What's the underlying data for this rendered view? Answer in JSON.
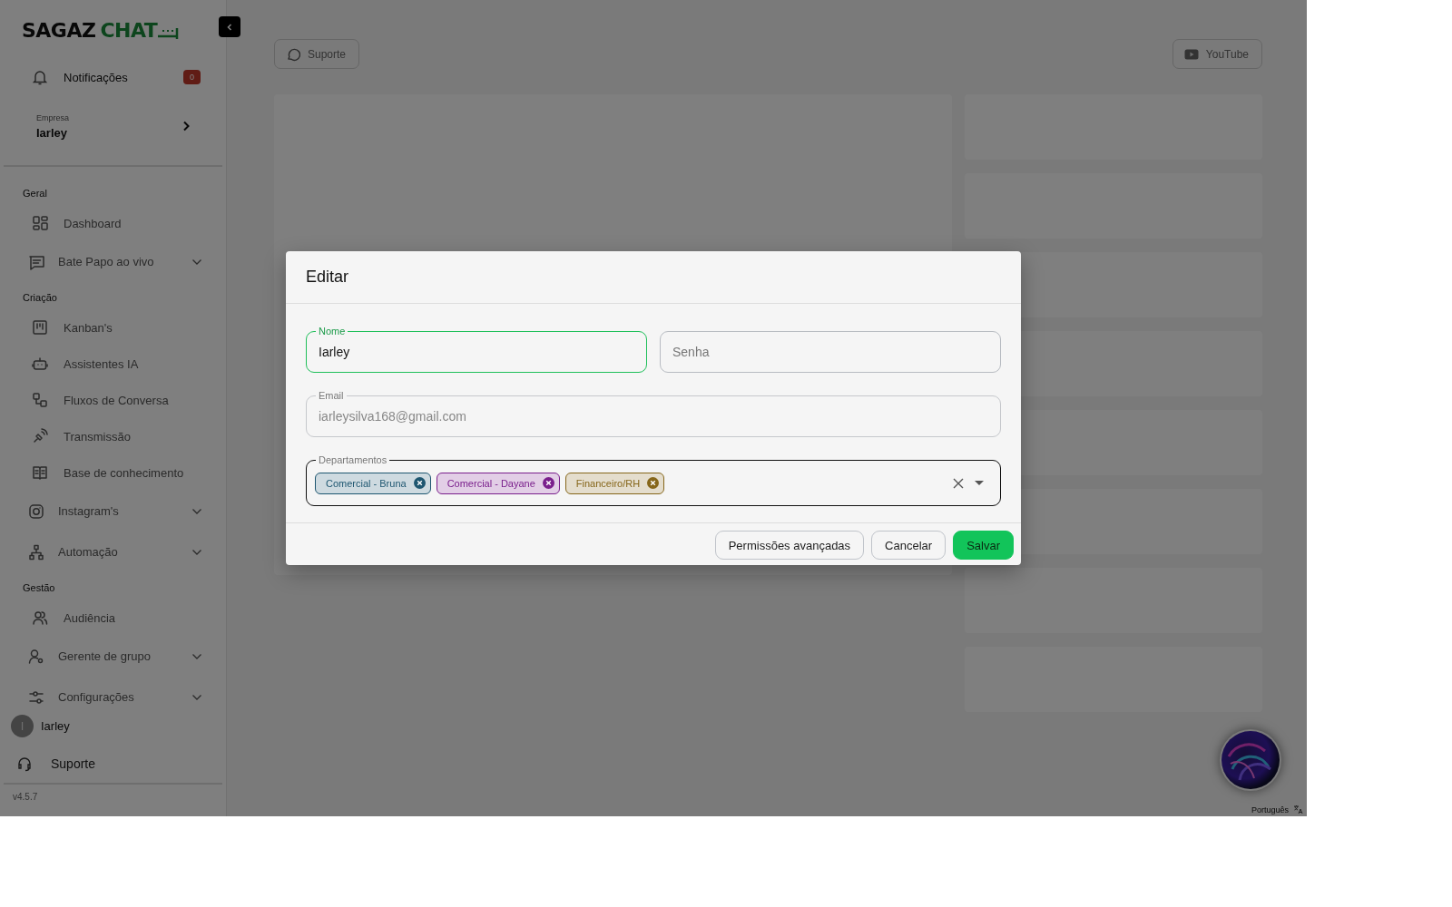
{
  "sidebar": {
    "logo": {
      "word_1": "SAGAZ",
      "word_2": "CHAT"
    },
    "notifications": {
      "label": "Notificações",
      "count": "0"
    },
    "company": {
      "label": "Empresa",
      "name": "Iarley"
    },
    "nav": [
      {
        "kind": "section",
        "label": "Geral"
      },
      {
        "kind": "item",
        "label": "Dashboard",
        "has_submenu": false
      },
      {
        "kind": "item",
        "label": "Bate Papo ao vivo",
        "has_submenu": true
      },
      {
        "kind": "section",
        "label": "Criação"
      },
      {
        "kind": "item",
        "label": "Kanban's",
        "has_submenu": false
      },
      {
        "kind": "item",
        "label": "Assistentes IA",
        "has_submenu": false
      },
      {
        "kind": "item",
        "label": "Fluxos de Conversa",
        "has_submenu": false
      },
      {
        "kind": "item",
        "label": "Transmissão",
        "has_submenu": false
      },
      {
        "kind": "item",
        "label": "Base de conhecimento",
        "has_submenu": false
      },
      {
        "kind": "item",
        "label": "Instagram's",
        "has_submenu": true
      },
      {
        "kind": "item",
        "label": "Automação",
        "has_submenu": true
      },
      {
        "kind": "section",
        "label": "Gestão"
      },
      {
        "kind": "item",
        "label": "Audiência",
        "has_submenu": false
      },
      {
        "kind": "item",
        "label": "Gerente de grupo",
        "has_submenu": true
      },
      {
        "kind": "item",
        "label": "Configurações",
        "has_submenu": true
      }
    ],
    "user": {
      "initial": "I",
      "name": "Iarley"
    },
    "support": "Suporte",
    "version": "v4.5.7"
  },
  "topbar": {
    "buttons": [
      {
        "kind": "whatsapp",
        "label": "Suporte"
      },
      {
        "kind": "youtube",
        "label": "YouTube"
      }
    ]
  },
  "language": "Português",
  "dialog": {
    "title": "Editar",
    "name_field": {
      "label": "Nome",
      "value": "Iarley",
      "focused": true
    },
    "password_field": {
      "placeholder": "Senha"
    },
    "email_field": {
      "label": "Email",
      "value": "iarleysilva168@gmail.com",
      "disabled": true
    },
    "departments_field": {
      "label": "Departamentos",
      "chips": [
        {
          "label": "Comercial - Bruna",
          "color": "#1e5670"
        },
        {
          "label": "Comercial - Dayane",
          "color": "#7a1f8c"
        },
        {
          "label": "Financeiro/RH",
          "color": "#86661a"
        }
      ]
    },
    "buttons": [
      {
        "kind": "secondary",
        "label": "Permissões avançadas"
      },
      {
        "kind": "secondary",
        "label": "Cancelar"
      },
      {
        "kind": "primary",
        "label": "Salvar"
      }
    ]
  }
}
